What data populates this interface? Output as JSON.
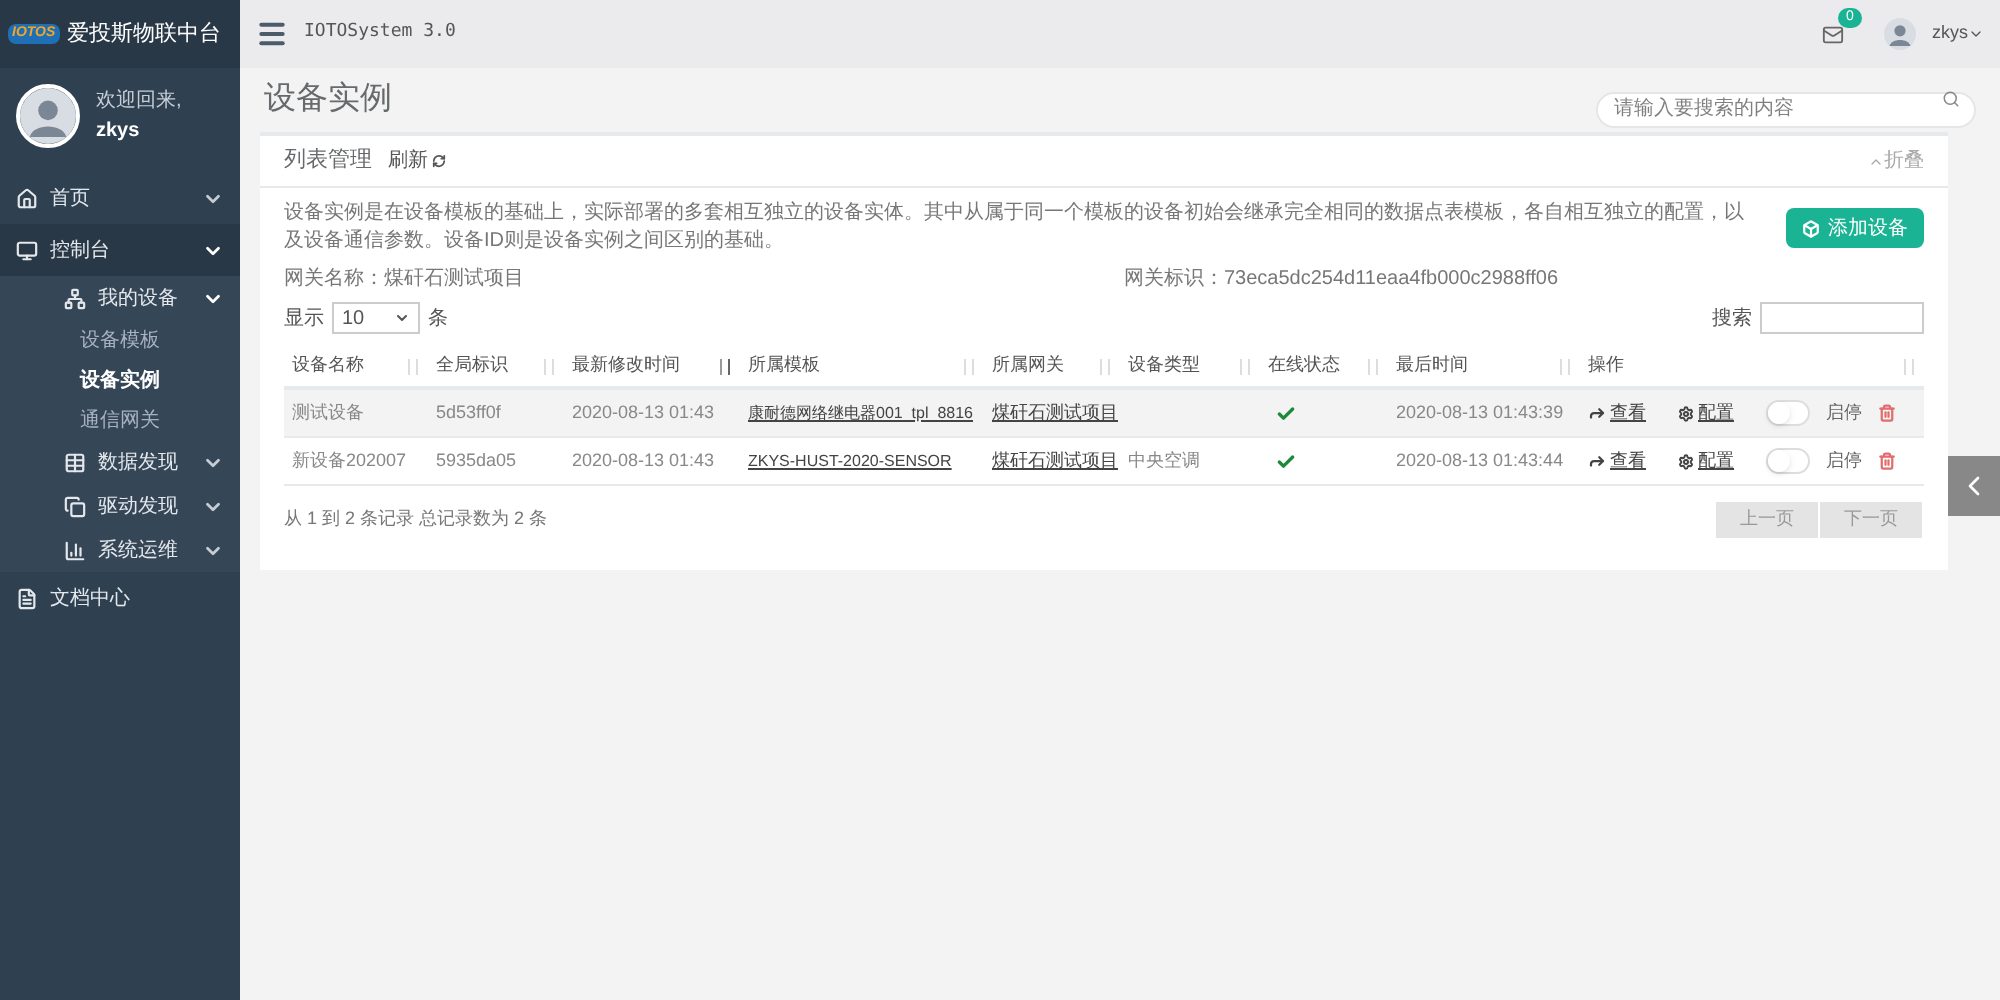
{
  "sidebar": {
    "logo": "IOTOS",
    "brand": "爱投斯物联中台",
    "welcome": "欢迎回来,",
    "user": "zkys",
    "items": [
      {
        "label": "首页",
        "expanded": false
      },
      {
        "label": "控制台",
        "expanded": true,
        "children": [
          {
            "label": "我的设备",
            "expanded": true,
            "children": [
              {
                "label": "设备模板",
                "selected": false
              },
              {
                "label": "设备实例",
                "selected": true
              },
              {
                "label": "通信网关",
                "selected": false
              }
            ]
          },
          {
            "label": "数据发现",
            "expanded": false
          },
          {
            "label": "驱动发现",
            "expanded": false
          },
          {
            "label": "系统运维",
            "expanded": false
          }
        ]
      },
      {
        "label": "文档中心"
      }
    ]
  },
  "topbar": {
    "title": "IOTOSystem 3.0",
    "mail_count": "0",
    "user": "zkys"
  },
  "page": {
    "title": "设备实例",
    "search": {
      "placeholder": "请输入要搜索的内容"
    }
  },
  "card": {
    "title": "列表管理",
    "refresh": "刷新",
    "collapse": "折叠",
    "description": "设备实例是在设备模板的基础上，实际部署的多套相互独立的设备实体。其中从属于同一个模板的设备初始会继承完全相同的数据点表模板，各自相互独立的配置，以及设备通信参数。设备ID则是设备实例之间区别的基础。",
    "gateway_name": "网关名称：煤矸石测试项目",
    "gateway_id": "网关标识：73eca5dc254d11eaa4fb000c2988ff06",
    "add_button": "添加设备",
    "page_size": {
      "label": "显示",
      "value": "10",
      "unit": "条"
    },
    "search_label": "搜索",
    "columns": [
      {
        "label": "设备名称",
        "sorted": false
      },
      {
        "label": "全局标识",
        "sorted": false
      },
      {
        "label": "最新修改时间",
        "sorted": true
      },
      {
        "label": "所属模板",
        "sorted": false
      },
      {
        "label": "所属网关",
        "sorted": false
      },
      {
        "label": "设备类型",
        "sorted": false
      },
      {
        "label": "在线状态",
        "sorted": false
      },
      {
        "label": "最后时间",
        "sorted": false
      },
      {
        "label": "操作",
        "sorted": false
      }
    ],
    "rows": [
      {
        "name": "测试设备",
        "id": "5d53ff0f",
        "modified": "2020-08-13 01:43",
        "template": "康耐德网络继电器001_tpl_8816",
        "gateway": "煤矸石测试项目",
        "online": true,
        "last_time": "2020-08-13 01:43:39",
        "view": "查看",
        "config": "配置",
        "toggle": "启停",
        "on": false,
        "highlighted": true
      },
      {
        "name": "新设备202007",
        "id": "5935da05",
        "modified": "2020-08-13 01:43",
        "template": "ZKYS-HUST-2020-SENSOR",
        "gateway": "煤矸石测试项目",
        "type": "中央空调",
        "online": true,
        "last_time": "2020-08-13 01:43:44",
        "view": "查看",
        "config": "配置",
        "toggle": "启停",
        "on": false,
        "highlighted": false
      }
    ],
    "summary": "从 1 到 2 条记录 总记录数为 2 条",
    "pager": [
      "上一页",
      "下一页"
    ]
  }
}
